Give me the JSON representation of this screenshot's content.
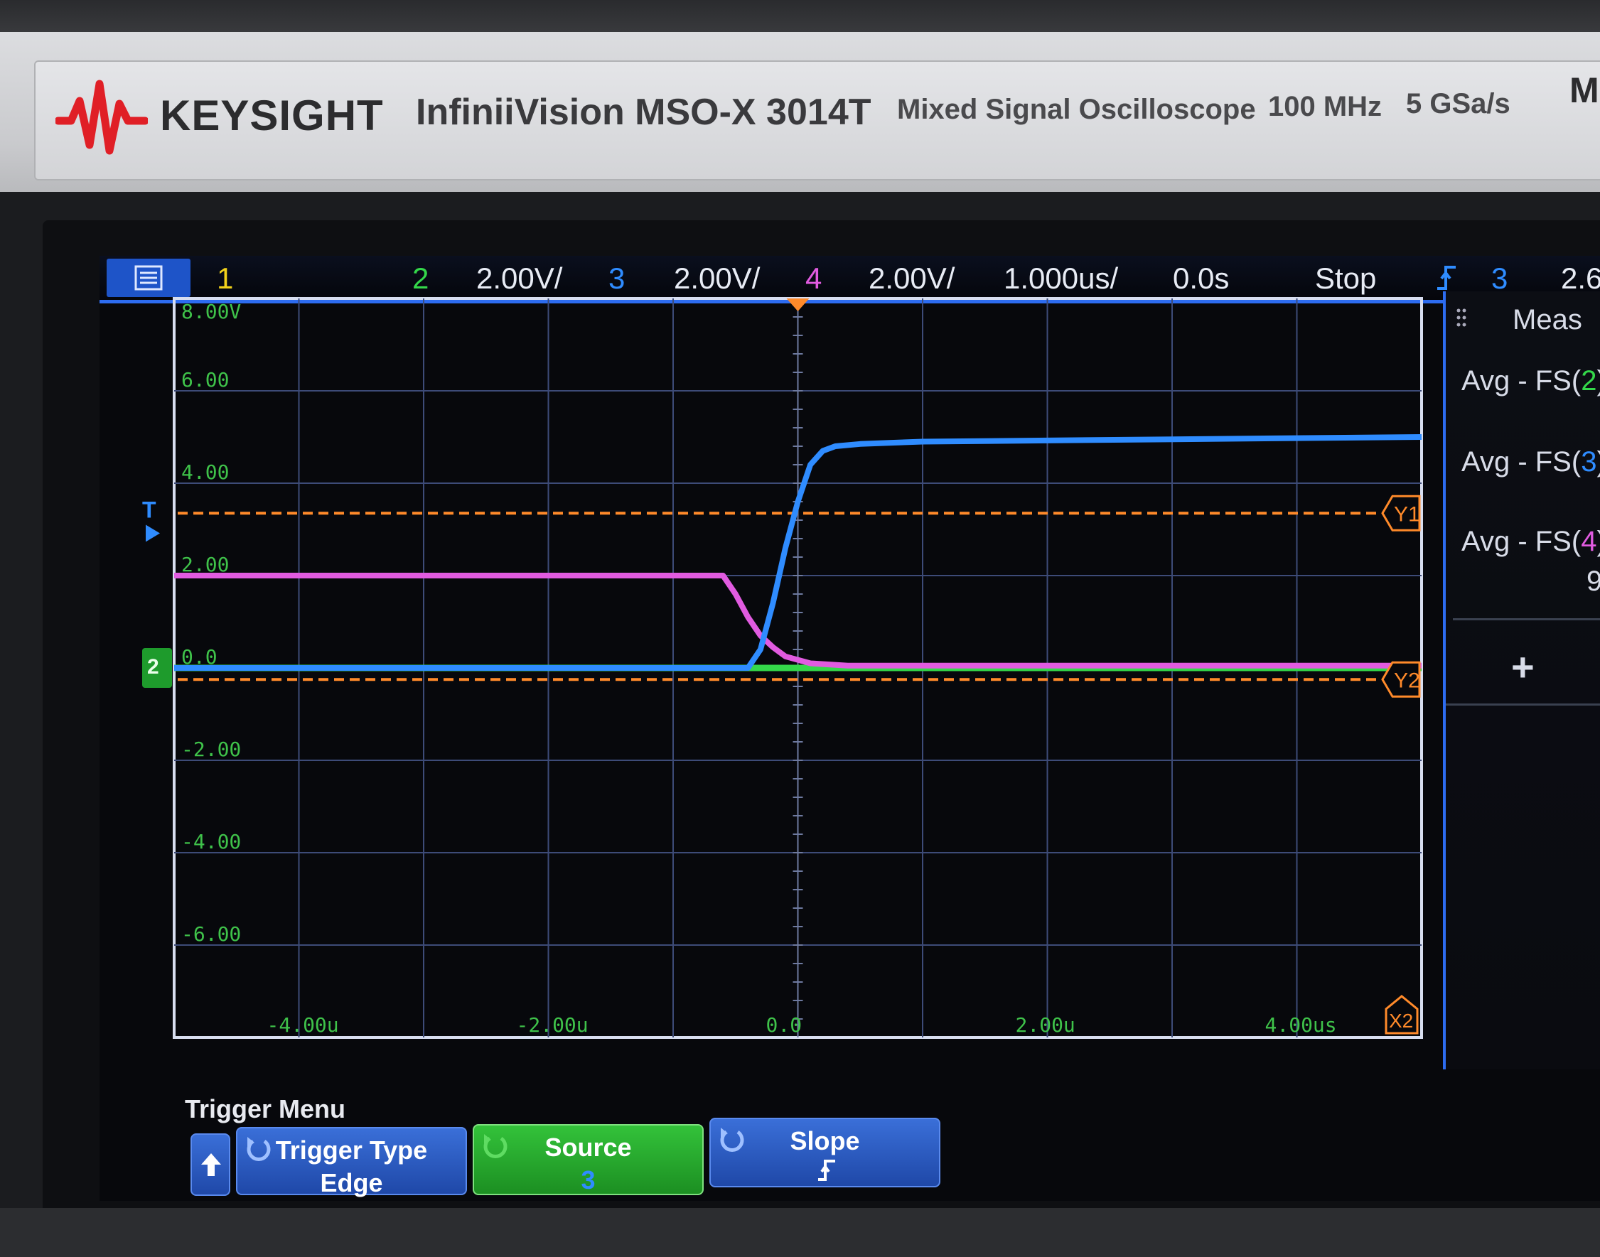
{
  "brand": {
    "name": "KEYSIGHT",
    "model": "InfiniiVision MSO-X 3014T",
    "description": "Mixed Signal Oscilloscope",
    "bandwidth": "100 MHz",
    "sample_rate": "5 GSa/s",
    "model_suffix": "MI"
  },
  "status_bar": {
    "ch1_label": "1",
    "ch2_label": "2",
    "ch2_scale": "2.00V/",
    "ch3_label": "3",
    "ch3_scale": "2.00V/",
    "ch4_label": "4",
    "ch4_scale": "2.00V/",
    "timebase": "1.000us/",
    "delay": "0.0s",
    "run_state": "Stop",
    "trigger_slope_icon": "rising-edge-icon",
    "trigger_source": "3",
    "trigger_level": "2.6"
  },
  "display": {
    "y_tick_labels": [
      "8.00V",
      "6.00",
      "4.00",
      "2.00",
      "0.0",
      "-2.00",
      "-4.00",
      "-6.00"
    ],
    "x_tick_labels": [
      "-4.00u",
      "-2.00u",
      "0.0",
      "2.00u",
      "4.00us"
    ],
    "cursor_y1": "Y1",
    "cursor_y2": "Y2",
    "cursor_x2": "X2",
    "trigger_marker": "T",
    "ground_marker": "2"
  },
  "chart_data": {
    "type": "line",
    "xlabel": "",
    "ylabel": "",
    "xlim": [
      -5.0,
      5.0
    ],
    "ylim": [
      -8.0,
      8.0
    ],
    "x_unit": "us",
    "y_unit": "V",
    "grid": true,
    "series": [
      {
        "channel": "3",
        "color": "#2f8cff",
        "x": [
          -5.0,
          -0.4,
          -0.3,
          -0.2,
          -0.1,
          0.0,
          0.1,
          0.2,
          0.3,
          0.5,
          1.0,
          5.0
        ],
        "y": [
          0.0,
          0.0,
          0.4,
          1.4,
          2.6,
          3.6,
          4.4,
          4.7,
          4.8,
          4.85,
          4.9,
          5.0
        ]
      },
      {
        "channel": "4",
        "color": "#e15be0",
        "x": [
          -5.0,
          -0.6,
          -0.5,
          -0.4,
          -0.3,
          -0.2,
          -0.1,
          0.1,
          0.4,
          5.0
        ],
        "y": [
          2.0,
          2.0,
          1.6,
          1.1,
          0.7,
          0.45,
          0.25,
          0.1,
          0.05,
          0.05
        ]
      },
      {
        "channel": "2",
        "color": "#34d84a",
        "x": [
          -5.0,
          5.0
        ],
        "y": [
          0.0,
          0.0
        ]
      }
    ],
    "cursors": {
      "Y1": 3.35,
      "Y2": -0.25,
      "color": "#ff8a2a"
    }
  },
  "measurements": {
    "title": "Meas",
    "items": [
      {
        "label_prefix": "Avg - FS(",
        "channel": "2",
        "label_suffix": "):",
        "value": ""
      },
      {
        "label_prefix": "Avg - FS(",
        "channel": "3",
        "label_suffix": "):",
        "value": ""
      },
      {
        "label_prefix": "Avg - FS(",
        "channel": "4",
        "label_suffix": "):",
        "value": "9"
      }
    ],
    "add_label": "+"
  },
  "trigger_menu": {
    "title": "Trigger Menu",
    "back_icon": "up-arrow-icon",
    "type_label": "Trigger Type",
    "type_value": "Edge",
    "source_label": "Source",
    "source_value": "3",
    "slope_label": "Slope",
    "slope_icon": "rising-edge-icon"
  },
  "colors": {
    "ch1": "#f2d21b",
    "ch2": "#34d84a",
    "ch3": "#2f8cff",
    "ch4": "#e15be0",
    "cursor": "#ff8a2a",
    "accent": "#2d6cf0"
  }
}
